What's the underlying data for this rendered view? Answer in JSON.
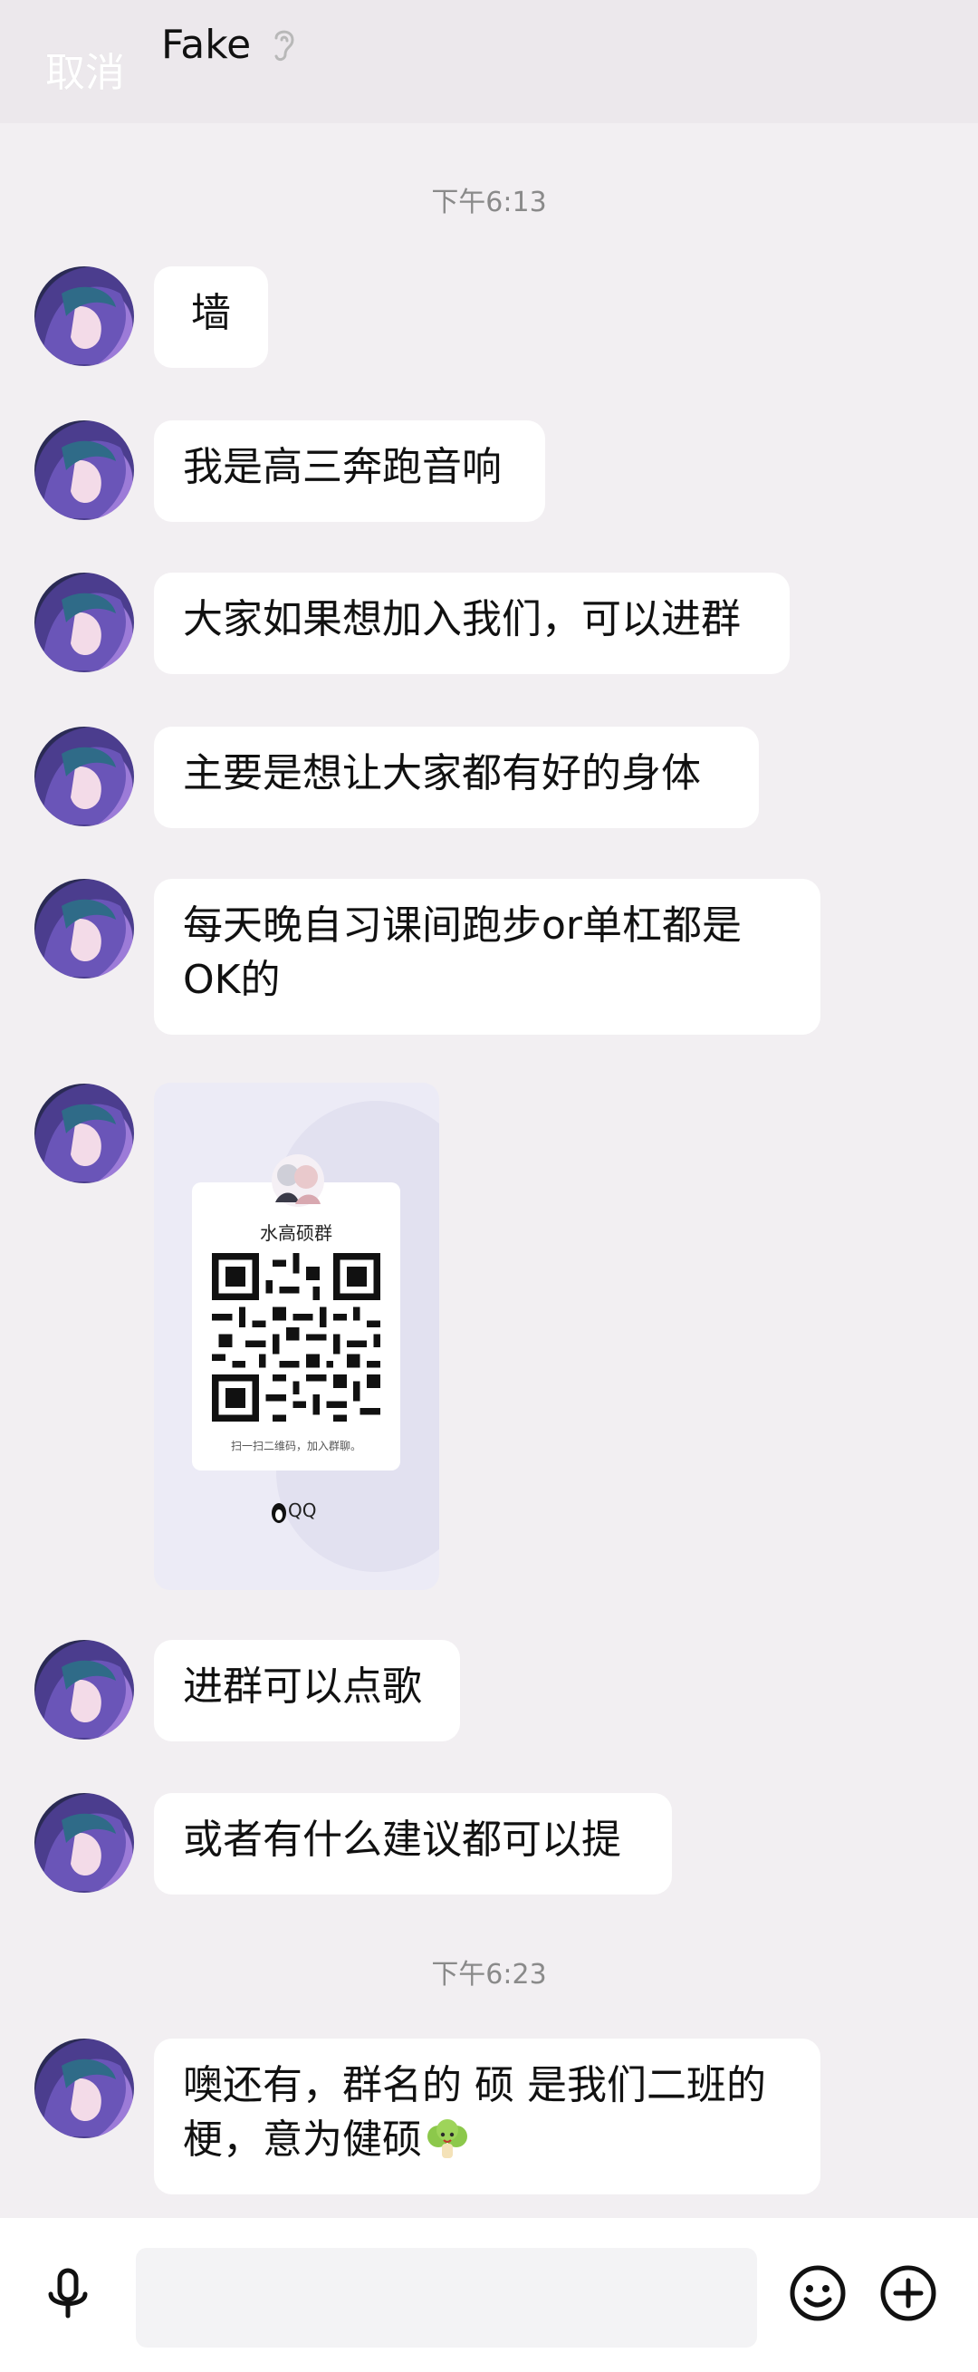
{
  "header": {
    "cancel_label": "取消",
    "contact_name": "Fake"
  },
  "timestamps": [
    "下午6:13",
    "下午6:23"
  ],
  "messages": [
    {
      "text": "墙"
    },
    {
      "text": "我是高三奔跑音响"
    },
    {
      "text": "大家如果想加入我们，可以进群"
    },
    {
      "text": "主要是想让大家都有好的身体"
    },
    {
      "text": "每天晚自习课间跑步or单杠都是OK的"
    },
    {
      "type": "qr-card",
      "group_name": "水高硕群",
      "hint": "扫一扫二维码，加入群聊。",
      "brand": "QQ"
    },
    {
      "text": "进群可以点歌"
    },
    {
      "text": "或者有什么建议都可以提"
    },
    {
      "text": "噢还有，群名的 硕 是我们二班的梗，意为健硕"
    }
  ],
  "input": {
    "placeholder": ""
  },
  "colors": {
    "background": "#f2eff2",
    "bubble": "#ffffff",
    "header": "#ece8ec"
  }
}
